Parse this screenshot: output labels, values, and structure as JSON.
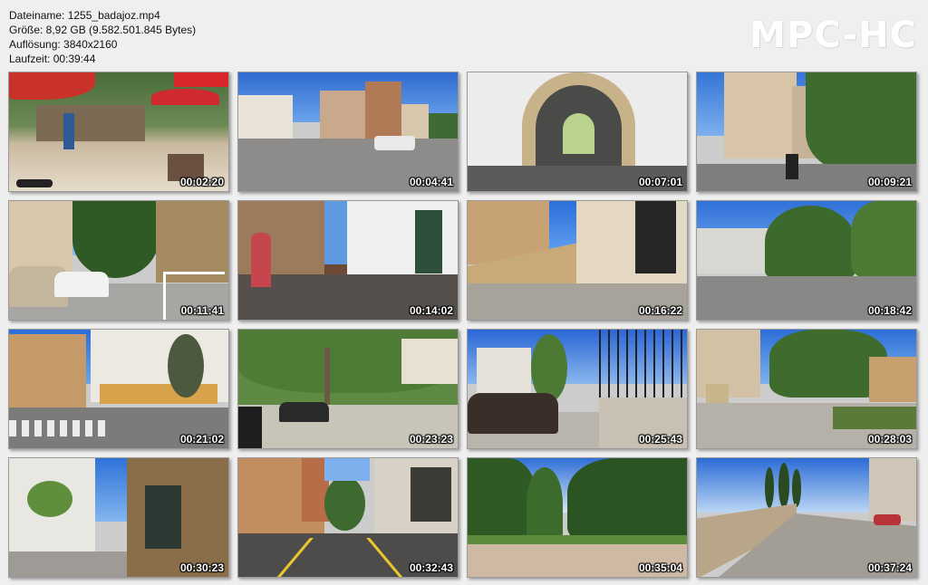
{
  "info": {
    "filename": "Dateiname: 1255_badajoz.mp4",
    "size": "Größe: 8,92 GB (9.582.501.845 Bytes)",
    "resolution": "Auflösung: 3840x2160",
    "duration": "Laufzeit: 00:39:44"
  },
  "logo": "MPC-HC",
  "thumbnails": [
    {
      "time": "00:02:20",
      "scene": "plaza-umbrellas"
    },
    {
      "time": "00:04:41",
      "scene": "street-buildings"
    },
    {
      "time": "00:07:01",
      "scene": "stone-arch"
    },
    {
      "time": "00:09:21",
      "scene": "street-trees"
    },
    {
      "time": "00:11:41",
      "scene": "parked-cars"
    },
    {
      "time": "00:14:02",
      "scene": "narrow-street"
    },
    {
      "time": "00:16:22",
      "scene": "wall-walkway"
    },
    {
      "time": "00:18:42",
      "scene": "square-trees"
    },
    {
      "time": "00:21:02",
      "scene": "crosswalk-buildings"
    },
    {
      "time": "00:23:23",
      "scene": "tree-avenue"
    },
    {
      "time": "00:25:43",
      "scene": "sidewalk-fence"
    },
    {
      "time": "00:28:03",
      "scene": "park-path"
    },
    {
      "time": "00:30:23",
      "scene": "shop-street"
    },
    {
      "time": "00:32:43",
      "scene": "yellow-line-street"
    },
    {
      "time": "00:35:04",
      "scene": "garden-path"
    },
    {
      "time": "00:37:24",
      "scene": "cypress-road"
    }
  ]
}
